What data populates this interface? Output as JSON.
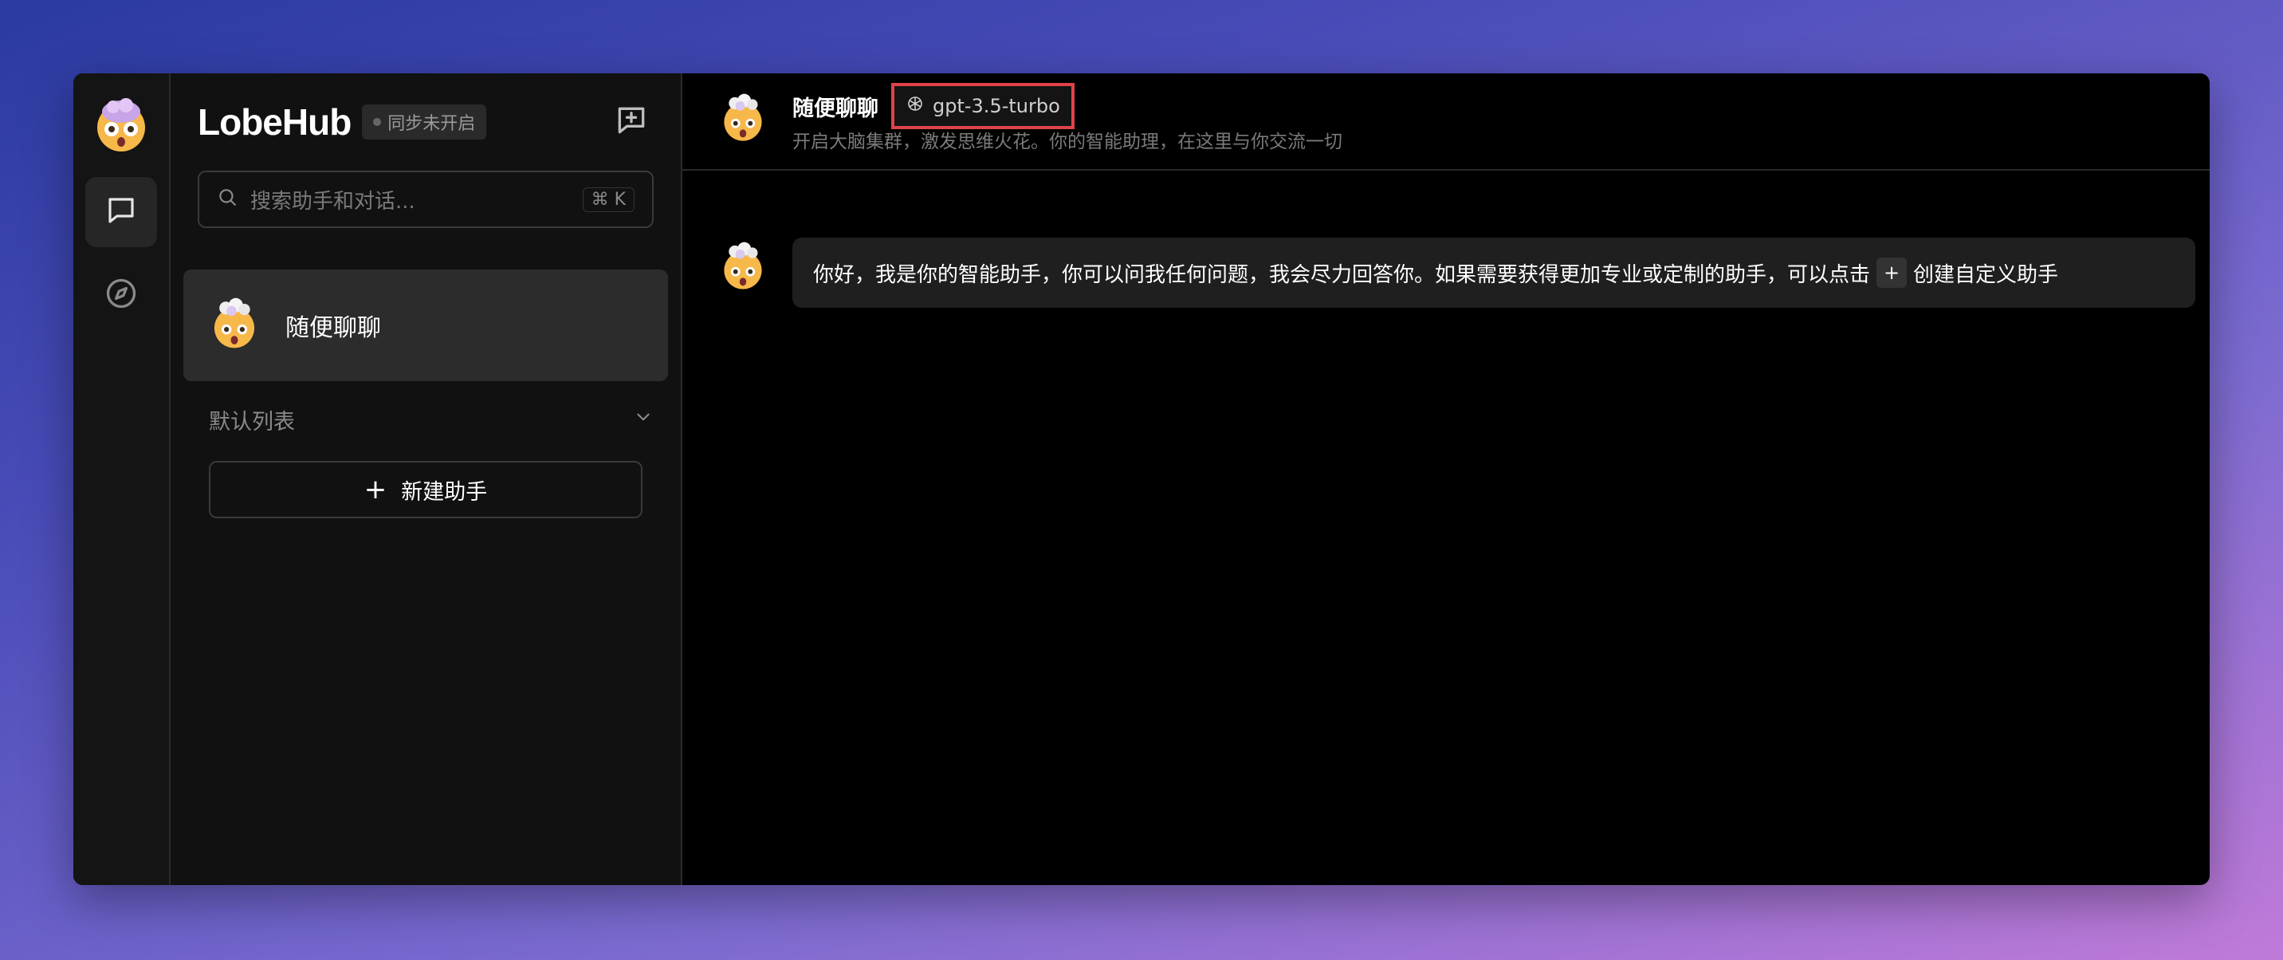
{
  "app": {
    "logo": "LobeHub",
    "sync_status": "同步未开启"
  },
  "rail": {
    "items": [
      {
        "name": "chat",
        "icon": "chat-bubble-icon",
        "active": true
      },
      {
        "name": "discover",
        "icon": "compass-icon",
        "active": false
      }
    ]
  },
  "sidebar": {
    "search_placeholder": "搜索助手和对话...",
    "search_shortcut": "⌘ K",
    "sessions": [
      {
        "name": "随便聊聊",
        "avatar": "exploding-head-emoji"
      }
    ],
    "group_label": "默认列表",
    "create_button": "新建助手",
    "create_button_icon": "+"
  },
  "chat": {
    "title": "随便聊聊",
    "model": "gpt-3.5-turbo",
    "description": "开启大脑集群，激发思维火花。你的智能助理，在这里与你交流一切",
    "messages": [
      {
        "role": "assistant",
        "text_before": "你好，我是你的智能助手，你可以问我任何问题，我会尽力回答你。如果需要获得更加专业或定制的助手，可以点击",
        "inline_button": "+",
        "text_after": "创建自定义助手"
      }
    ]
  },
  "colors": {
    "highlight_border": "#e0424a",
    "background_gradient_start": "#2a3aa0",
    "background_gradient_end": "#c07ad8"
  }
}
